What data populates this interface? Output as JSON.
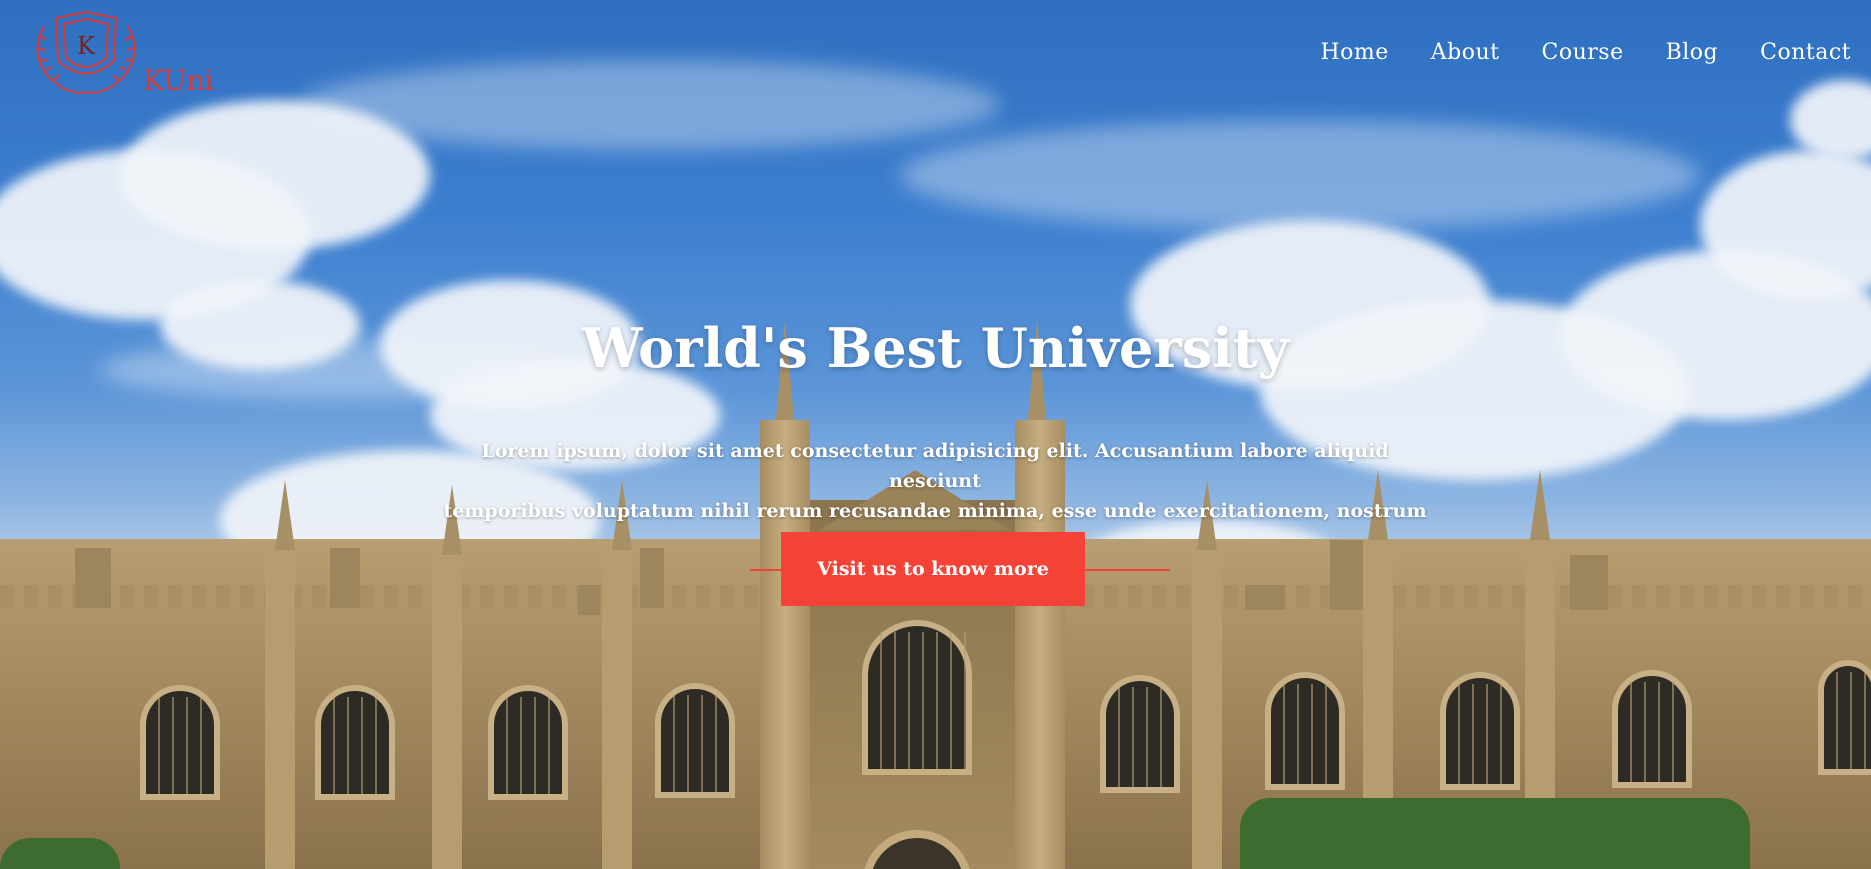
{
  "brand": {
    "name": "KUni",
    "monogram": "K",
    "color": "#d93a37"
  },
  "nav": {
    "items": [
      "Home",
      "About",
      "Course",
      "Blog",
      "Contact"
    ]
  },
  "hero": {
    "title": "World's Best University",
    "description_line1": "Lorem ipsum, dolor sit amet consectetur adipisicing elit. Accusantium labore aliquid nesciunt",
    "description_line2": "temporibus voluptatum nihil rerum recusandae minima, esse unde exercitationem, nostrum atque !",
    "cta_label": "Visit us to know more",
    "accent": "#f44336"
  }
}
